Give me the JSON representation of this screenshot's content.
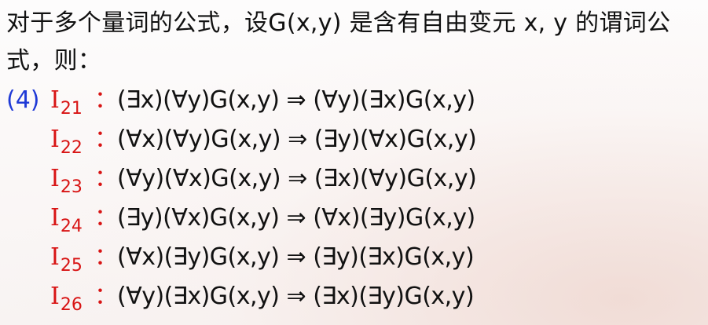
{
  "intro": "对于多个量词的公式，设G(x,y) 是含有自由变元 x, y 的谓词公式，则：",
  "number": "(4)",
  "formulas": [
    {
      "letter": "I",
      "sub": "21",
      "colon": "：",
      "expr": "(∃x)(∀y)G(x,y) ⇒ (∀y)(∃x)G(x,y)"
    },
    {
      "letter": "I",
      "sub": "22",
      "colon": "：",
      "expr": "(∀x)(∀y)G(x,y) ⇒ (∃y)(∀x)G(x,y)"
    },
    {
      "letter": "I",
      "sub": "23",
      "colon": "：",
      "expr": "(∀y)(∀x)G(x,y) ⇒ (∃x)(∀y)G(x,y)"
    },
    {
      "letter": "I",
      "sub": "24",
      "colon": "：",
      "expr": "(∃y)(∀x)G(x,y) ⇒ (∀x)(∃y)G(x,y)"
    },
    {
      "letter": "I",
      "sub": "25",
      "colon": "：",
      "expr": "(∀x)(∃y)G(x,y) ⇒ (∃y)(∃x)G(x,y)"
    },
    {
      "letter": "I",
      "sub": "26",
      "colon": "：",
      "expr": "(∀y)(∃x)G(x,y) ⇒ (∃x)(∃y)G(x,y)"
    }
  ],
  "colors": {
    "number": "#1f39d6",
    "label": "#d81414",
    "text": "#111111"
  }
}
